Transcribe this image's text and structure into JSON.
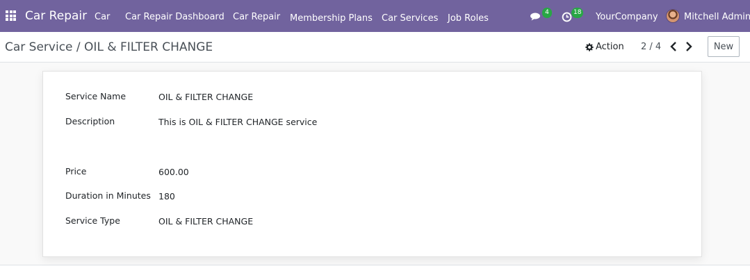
{
  "navbar": {
    "brand": "Car Repair",
    "menu": [
      "Car",
      "Car Repair Dashboard",
      "Car Repair",
      "Membership Plans",
      "Car Services",
      "Job Roles"
    ],
    "messages_count": "4",
    "activities_count": "18",
    "company": "YourCompany",
    "user": "Mitchell Admin",
    "icons": [
      "apps-grid-icon",
      "chat-icon",
      "clock-icon",
      "avatar"
    ],
    "bg_color": "#71639e",
    "badge_color": "#28a745"
  },
  "control": {
    "breadcrumb": "Car Service / OIL & FILTER CHANGE",
    "action_label": "Action",
    "pager": "2 / 4",
    "new_label": "New"
  },
  "form": {
    "fields": [
      {
        "label": "Service Name",
        "value": "OIL & FILTER CHANGE"
      },
      {
        "label": "Description",
        "value": "This is OIL & FILTER CHANGE service"
      },
      {
        "label": "Price",
        "value": "600.00"
      },
      {
        "label": "Duration in Minutes",
        "value": "180"
      },
      {
        "label": "Service Type",
        "value": "OIL & FILTER CHANGE"
      }
    ]
  }
}
